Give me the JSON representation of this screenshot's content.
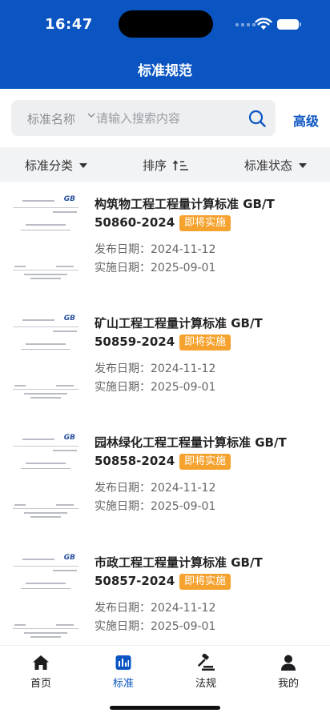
{
  "status_bar": {
    "time": "16:47"
  },
  "header": {
    "title": "标准规范"
  },
  "search": {
    "field_label": "标准名称",
    "placeholder": "请输入搜索内容",
    "advanced_label": "高级"
  },
  "filters": [
    {
      "label": "标准分类",
      "icon": "caret-down-icon"
    },
    {
      "label": "排序",
      "icon": "sort-ascending-icon"
    },
    {
      "label": "标准状态",
      "icon": "caret-down-icon"
    }
  ],
  "labels": {
    "publish": "发布日期：",
    "implement": "实施日期："
  },
  "standards": [
    {
      "title": "构筑物工程工程量计算标准 GB/T",
      "code": "50860-2024",
      "status": "即将实施",
      "publish_date": "2024-11-12",
      "implement_date": "2025-09-01"
    },
    {
      "title": "矿山工程工程量计算标准 GB/T",
      "code": "50859-2024",
      "status": "即将实施",
      "publish_date": "2024-11-12",
      "implement_date": "2025-09-01"
    },
    {
      "title": "园林绿化工程工程量计算标准 GB/T",
      "code": "50858-2024",
      "status": "即将实施",
      "publish_date": "2024-11-12",
      "implement_date": "2025-09-01"
    },
    {
      "title": "市政工程工程量计算标准 GB/T",
      "code": "50857-2024",
      "status": "即将实施",
      "publish_date": "2024-11-12",
      "implement_date": "2025-09-01"
    }
  ],
  "thumbnail_mark": "GB",
  "tabs": [
    {
      "label": "首页",
      "icon": "home-icon",
      "active": false
    },
    {
      "label": "标准",
      "icon": "standards-icon",
      "active": true
    },
    {
      "label": "法规",
      "icon": "gavel-icon",
      "active": false
    },
    {
      "label": "我的",
      "icon": "user-icon",
      "active": false
    }
  ],
  "colors": {
    "primary": "#0a55c2",
    "badge": "#f5a22e"
  }
}
